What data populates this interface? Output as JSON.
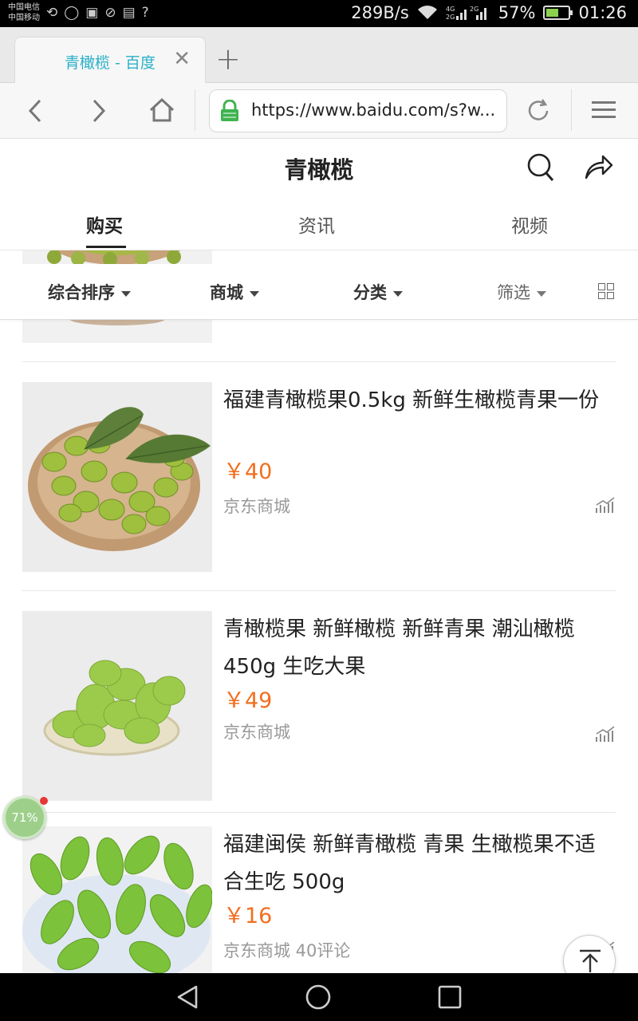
{
  "status_bar": {
    "carrier_1": "中国电信",
    "carrier_2": "中国移动",
    "net_speed": "289B/s",
    "battery": "57%",
    "battery_level": 0.57,
    "time": "01:26"
  },
  "browser": {
    "tab_title": "青橄榄 - 百度",
    "url": "https://www.baidu.com/s?w..."
  },
  "search": {
    "query": "青橄榄"
  },
  "category_tabs": [
    {
      "label": "购买",
      "active": true
    },
    {
      "label": "资讯",
      "active": false
    },
    {
      "label": "视频",
      "active": false
    }
  ],
  "filters": [
    {
      "label": "综合排序"
    },
    {
      "label": "商城"
    },
    {
      "label": "分类"
    },
    {
      "label": "筛选"
    }
  ],
  "products": [
    {
      "title": "福建青橄榄果0.5kg 新鲜生橄榄青果一份",
      "price": "￥40",
      "shop": "京东商城"
    },
    {
      "title": "青橄榄果 新鲜橄榄 新鲜青果 潮汕橄榄450g 生吃大果",
      "price": "￥49",
      "shop": "京东商城"
    },
    {
      "title": "福建闽侯 新鲜青橄榄 青果 生橄榄果不适合生吃 500g",
      "price": "￥16",
      "shop": "京东商城 40评论"
    }
  ],
  "floating": {
    "progress": "71%"
  },
  "colors": {
    "accent_price": "#f26e1e",
    "tab_title": "#2ab0c8",
    "lock_green": "#3fb34f"
  }
}
